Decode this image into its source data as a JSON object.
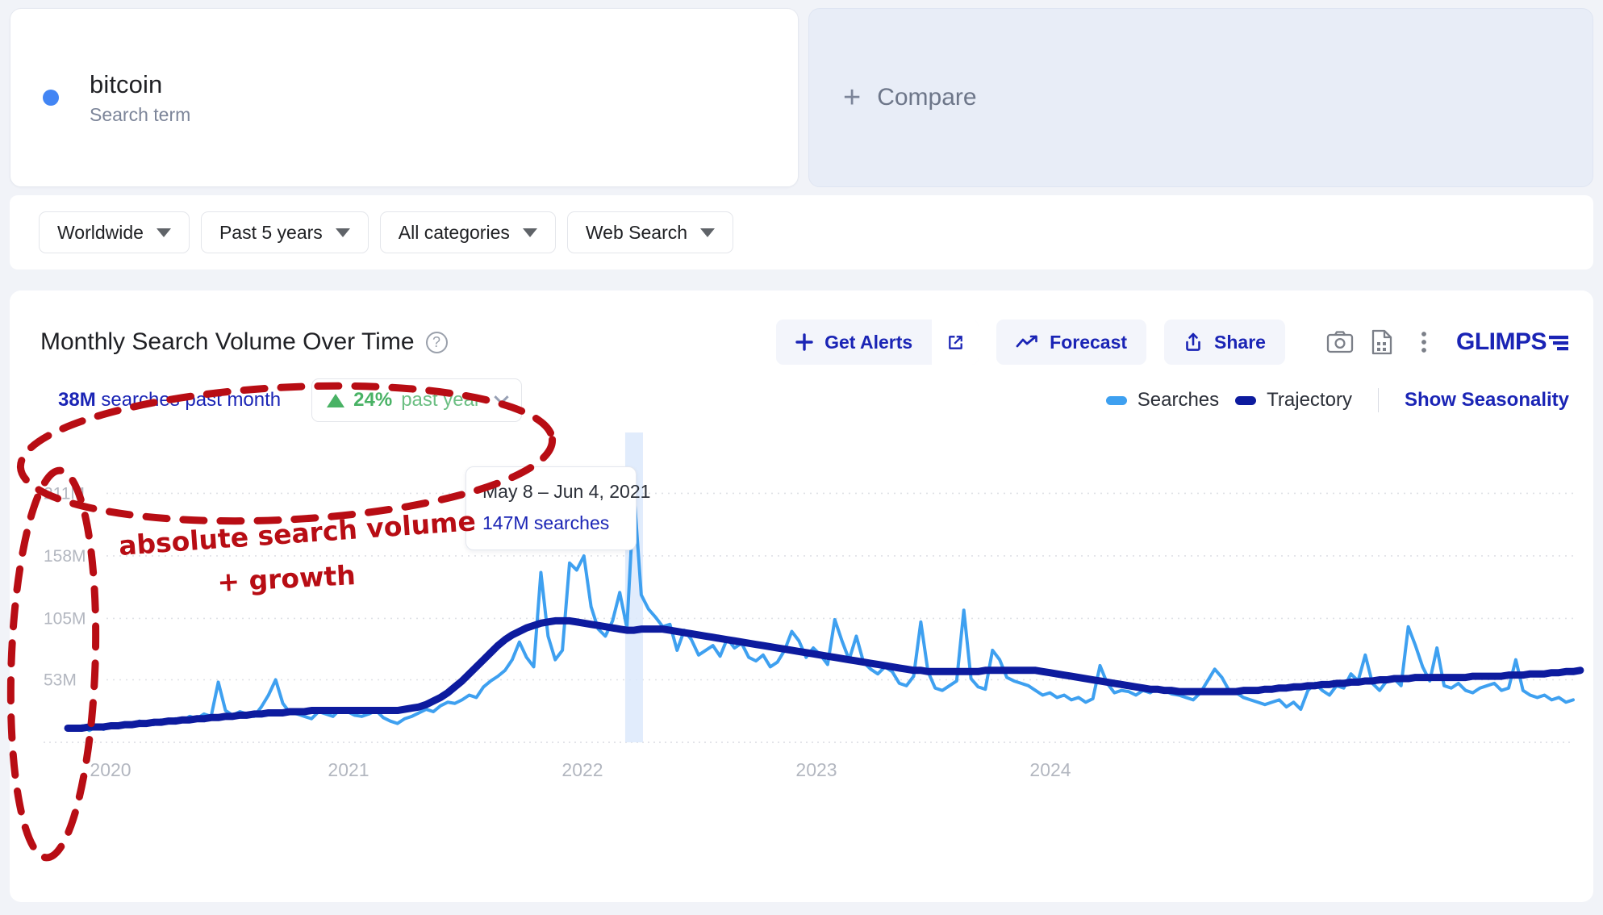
{
  "term": {
    "name": "bitcoin",
    "subtitle": "Search term",
    "dot_color": "#4285f4"
  },
  "compare": {
    "plus": "+",
    "label": "Compare"
  },
  "filters": [
    {
      "label": "Worldwide"
    },
    {
      "label": "Past 5 years"
    },
    {
      "label": "All categories"
    },
    {
      "label": "Web Search"
    }
  ],
  "chart_header": {
    "title": "Monthly Search Volume Over Time",
    "help": "?",
    "buttons": [
      {
        "name": "get-alerts",
        "label": "Get Alerts",
        "icon": "plus-icon"
      },
      {
        "name": "open-external",
        "label": "",
        "icon": "external-link-icon"
      },
      {
        "name": "forecast",
        "label": "Forecast",
        "icon": "trend-up-icon"
      },
      {
        "name": "share",
        "label": "Share",
        "icon": "share-upload-icon"
      }
    ],
    "icons": [
      {
        "name": "camera-icon"
      },
      {
        "name": "document-icon"
      },
      {
        "name": "more-vertical-icon"
      }
    ],
    "brand": "GLIMPS",
    "brand_color": "#1a24b5"
  },
  "stats": {
    "volume_value": "38M",
    "volume_label": " searches past month",
    "growth_value": "24%",
    "growth_label": "past year",
    "growth_color": "#49b265"
  },
  "legend": {
    "items": [
      {
        "label": "Searches",
        "color": "#3ea0f0"
      },
      {
        "label": "Trajectory",
        "color": "#0d1b9e"
      }
    ],
    "link": "Show Seasonality"
  },
  "tooltip": {
    "date_range": "May 8 – Jun 4, 2021",
    "value": "147M searches"
  },
  "annotations": [
    {
      "name": "ellipse-stats",
      "text": ""
    },
    {
      "name": "ellipse-yaxis",
      "text": ""
    },
    {
      "name": "handwritten-note-line1",
      "text": "absolute search volume"
    },
    {
      "name": "handwritten-note-line2",
      "text": "+ growth"
    }
  ],
  "annotation_color": "#b80d14",
  "chart_data": {
    "type": "line",
    "title": "Monthly Search Volume Over Time",
    "xlabel": "",
    "ylabel": "",
    "grid": true,
    "legend_position": "top-right",
    "ylim": [
      0,
      238
    ],
    "yticks": [
      53,
      105,
      158,
      211
    ],
    "ytick_labels": [
      "53M",
      "105M",
      "158M",
      "211M"
    ],
    "xticks": [
      "2020",
      "2021",
      "2022",
      "2023",
      "2024"
    ],
    "highlight_band": {
      "label": "May 8 – Jun 4, 2021",
      "value": 147,
      "unit": "searches"
    },
    "series": [
      {
        "name": "Searches",
        "color": "#3ea0f0",
        "values": [
          12,
          11,
          14,
          10,
          13,
          11,
          15,
          13,
          16,
          14,
          18,
          16,
          15,
          19,
          17,
          20,
          18,
          22,
          20,
          24,
          22,
          51,
          27,
          23,
          26,
          24,
          22,
          30,
          40,
          53,
          33,
          25,
          24,
          22,
          20,
          26,
          24,
          22,
          28,
          26,
          23,
          22,
          24,
          27,
          21,
          18,
          16,
          20,
          22,
          25,
          28,
          26,
          31,
          34,
          33,
          36,
          40,
          38,
          47,
          52,
          56,
          61,
          70,
          85,
          72,
          64,
          144,
          90,
          70,
          78,
          152,
          146,
          158,
          115,
          96,
          90,
          103,
          127,
          97,
          211,
          125,
          113,
          106,
          98,
          100,
          78,
          95,
          87,
          74,
          78,
          82,
          73,
          88,
          80,
          84,
          72,
          69,
          74,
          64,
          68,
          78,
          94,
          86,
          72,
          80,
          74,
          66,
          104,
          86,
          70,
          90,
          68,
          62,
          58,
          64,
          60,
          50,
          48,
          56,
          102,
          60,
          46,
          44,
          48,
          52,
          112,
          54,
          47,
          45,
          78,
          70,
          55,
          52,
          50,
          48,
          44,
          40,
          42,
          38,
          40,
          36,
          38,
          34,
          37,
          65,
          50,
          42,
          44,
          43,
          40,
          44,
          42,
          46,
          44,
          41,
          40,
          38,
          36,
          42,
          52,
          62,
          55,
          44,
          42,
          38,
          36,
          34,
          32,
          34,
          36,
          30,
          34,
          28,
          44,
          50,
          44,
          40,
          48,
          46,
          58,
          52,
          74,
          50,
          44,
          52,
          54,
          48,
          98,
          82,
          64,
          52,
          80,
          48,
          46,
          50,
          44,
          42,
          46,
          48,
          50,
          44,
          46,
          70,
          44,
          40,
          38,
          40,
          36,
          38,
          34,
          36
        ]
      },
      {
        "name": "Trajectory",
        "color": "#0d1b9e",
        "values": [
          12,
          12,
          12,
          13,
          13,
          13,
          14,
          14,
          15,
          15,
          16,
          16,
          17,
          17,
          18,
          18,
          19,
          19,
          20,
          20,
          21,
          21,
          22,
          22,
          23,
          23,
          24,
          24,
          25,
          25,
          25,
          26,
          26,
          26,
          27,
          27,
          27,
          27,
          27,
          27,
          27,
          27,
          27,
          27,
          27,
          27,
          27,
          28,
          29,
          30,
          32,
          35,
          38,
          42,
          47,
          52,
          58,
          64,
          70,
          76,
          82,
          87,
          91,
          94,
          97,
          99,
          101,
          102,
          103,
          103,
          103,
          102,
          101,
          100,
          99,
          98,
          97,
          96,
          95,
          95,
          96,
          96,
          96,
          96,
          95,
          94,
          93,
          92,
          91,
          90,
          89,
          88,
          87,
          86,
          85,
          84,
          83,
          82,
          81,
          80,
          79,
          78,
          77,
          76,
          75,
          74,
          73,
          72,
          71,
          70,
          69,
          68,
          67,
          66,
          65,
          64,
          63,
          62,
          61,
          61,
          60,
          60,
          60,
          60,
          60,
          60,
          60,
          60,
          61,
          61,
          61,
          61,
          61,
          61,
          61,
          61,
          60,
          59,
          58,
          57,
          56,
          55,
          54,
          53,
          52,
          51,
          50,
          49,
          48,
          47,
          46,
          45,
          45,
          44,
          44,
          43,
          43,
          43,
          43,
          43,
          43,
          43,
          43,
          43,
          44,
          44,
          44,
          45,
          45,
          46,
          46,
          47,
          47,
          48,
          48,
          49,
          49,
          50,
          50,
          51,
          51,
          52,
          52,
          53,
          53,
          54,
          54,
          54,
          55,
          55,
          55,
          55,
          55,
          55,
          55,
          55,
          56,
          56,
          56,
          56,
          56,
          57,
          57,
          57,
          58,
          58,
          58,
          59,
          59,
          60,
          60,
          61
        ]
      }
    ]
  }
}
